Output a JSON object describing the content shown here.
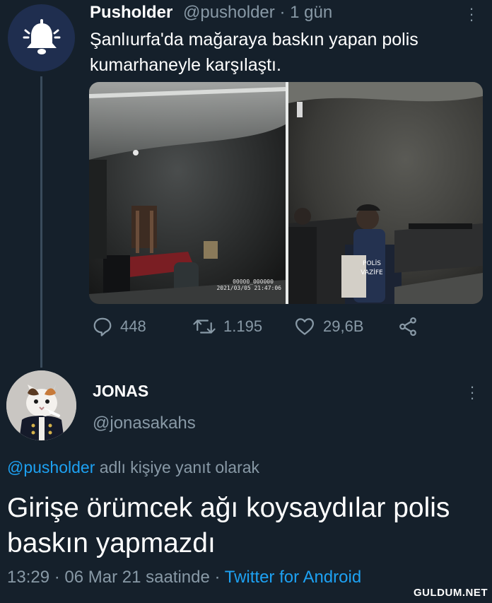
{
  "tweet": {
    "author_name": "Pusholder",
    "author_handle": "@pusholder",
    "separator": "·",
    "time": "1 gün",
    "text": "Şanlıurfa'da mağaraya baskın yapan polis kumarhaneyle karşılaştı.",
    "media_timestamp_line1": "00000_000000",
    "media_timestamp_line2": "2021/03/05 21:47:06",
    "replies": "448",
    "retweets": "1.195",
    "likes": "29,6B",
    "icons": [
      "bell-icon",
      "reply-icon",
      "retweet-icon",
      "like-icon",
      "share-icon",
      "more-icon"
    ]
  },
  "reply": {
    "author_name": "JONAS",
    "author_handle": "@jonasakahs",
    "reply_mention": "@pusholder",
    "reply_suffix": " adlı kişiye yanıt olarak",
    "text": "Girişe örümcek ağı koysaydılar polis baskın yapmazdı",
    "time": "13:29 · 06 Mar 21 saatinde · ",
    "client": "Twitter for Android"
  },
  "watermark": "GULDUM.NET",
  "colors": {
    "background": "#15202b",
    "accent": "#1da1f2",
    "secondary_text": "#8899a6",
    "avatar_bg": "#1f2e4f"
  }
}
